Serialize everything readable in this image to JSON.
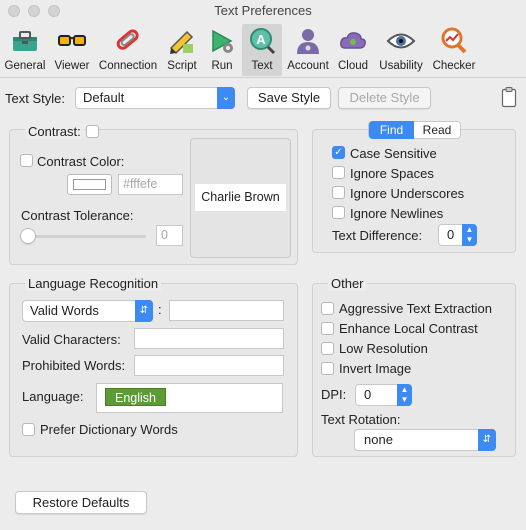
{
  "window": {
    "title": "Text Preferences"
  },
  "toolbar": {
    "items": [
      {
        "label": "General",
        "icon": "toolbox-icon"
      },
      {
        "label": "Viewer",
        "icon": "glasses-icon"
      },
      {
        "label": "Connection",
        "icon": "paperclip-icon"
      },
      {
        "label": "Script",
        "icon": "pencil-icon"
      },
      {
        "label": "Run",
        "icon": "play-gear-icon"
      },
      {
        "label": "Text",
        "icon": "text-search-icon"
      },
      {
        "label": "Account",
        "icon": "account-icon"
      },
      {
        "label": "Cloud",
        "icon": "cloud-icon"
      },
      {
        "label": "Usability",
        "icon": "eye-icon"
      },
      {
        "label": "Checker",
        "icon": "checker-magnifier-icon"
      }
    ],
    "active": "Text"
  },
  "text_style": {
    "label": "Text Style:",
    "value": "Default",
    "save_label": "Save Style",
    "delete_label": "Delete Style"
  },
  "contrast": {
    "label": "Contrast:",
    "checked": false,
    "color_label": "Contrast Color:",
    "color_placeholder": "#fffefe",
    "tolerance_label": "Contrast Tolerance:",
    "tolerance_placeholder": "0",
    "preview_text": "Charlie Brown"
  },
  "find_tabs": [
    "Find",
    "Read"
  ],
  "find": {
    "options": [
      {
        "label": "Case Sensitive",
        "checked": true
      },
      {
        "label": "Ignore Spaces",
        "checked": false
      },
      {
        "label": "Ignore Underscores",
        "checked": false
      },
      {
        "label": "Ignore Newlines",
        "checked": false
      }
    ],
    "difference_label": "Text Difference:",
    "difference_value": "0"
  },
  "language": {
    "title": "Language Recognition",
    "mode_value": "Valid Words",
    "colon": ":",
    "valid_chars_label": "Valid Characters:",
    "prohibited_label": "Prohibited Words:",
    "language_label": "Language:",
    "language_token": "English",
    "prefer_label": "Prefer Dictionary Words"
  },
  "other": {
    "title": "Other",
    "options": [
      {
        "label": "Aggressive Text Extraction",
        "checked": false
      },
      {
        "label": "Enhance Local Contrast",
        "checked": false
      },
      {
        "label": "Low Resolution",
        "checked": false
      },
      {
        "label": "Invert Image",
        "checked": false
      }
    ],
    "dpi_label": "DPI:",
    "dpi_value": "0",
    "rotation_label": "Text Rotation:",
    "rotation_value": "none"
  },
  "footer": {
    "restore_label": "Restore Defaults"
  },
  "colors": {
    "accent": "#3d8bf2",
    "token_bg": "#5e9a36"
  }
}
